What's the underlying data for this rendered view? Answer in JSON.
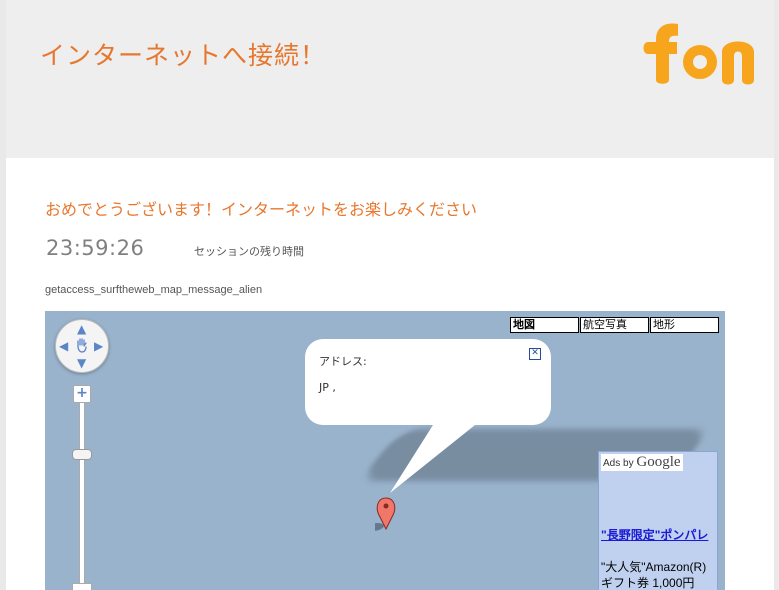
{
  "header": {
    "title": "インターネットへ接続！",
    "logo_text": "fon",
    "brand_color": "#f7a51c",
    "title_color": "#e8772e"
  },
  "main": {
    "subtitle": "おめでとうございます！インターネットをお楽しみください",
    "timer": "23:59:26",
    "timer_label": "セッションの残り時間",
    "message_key": "getaccess_surftheweb_map_message_alien"
  },
  "map": {
    "map_types": [
      {
        "label": "地図",
        "active": true
      },
      {
        "label": "航空写真",
        "active": false
      },
      {
        "label": "地形",
        "active": false
      }
    ],
    "info_window": {
      "label": "アドレス:",
      "value": "JP ,",
      "close_icon": "close-icon"
    },
    "marker_icon": "map-pin-icon",
    "pan_icon": "hand-icon",
    "zoom_in_label": "+",
    "map_color": "#99b3cc"
  },
  "ads": {
    "ads_by": "Ads by",
    "google": "Google",
    "link_text": "\"長野限定\"ポンパレ",
    "body_line1": "\"大人気\"Amazon(R)",
    "body_line2": "ギフト券 1,000円"
  }
}
